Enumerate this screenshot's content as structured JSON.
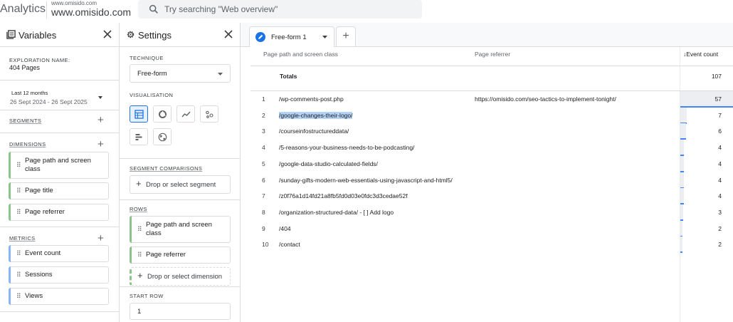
{
  "app": {
    "title": "Analytics",
    "property_small": "www.omisido.com",
    "property_name": "www.omisido.com",
    "search_placeholder": "Try searching \"Web overview\""
  },
  "variables": {
    "title": "Variables",
    "exploration_name_label": "EXPLORATION NAME:",
    "exploration_name": "404 Pages",
    "date_label": "Last 12 months",
    "date_range": "26 Sept 2024 - 26 Sept 2025",
    "segments_label": "SEGMENTS",
    "dimensions_label": "DIMENSIONS",
    "dimensions": [
      "Page path and screen class",
      "Page title",
      "Page referrer"
    ],
    "metrics_label": "METRICS",
    "metrics": [
      "Event count",
      "Sessions",
      "Views"
    ]
  },
  "settings": {
    "title": "Settings",
    "technique_label": "TECHNIQUE",
    "technique": "Free-form",
    "visualisation_label": "VISUALISATION",
    "visualisation_icons": [
      "table-icon",
      "donut-chart-icon",
      "line-chart-icon",
      "scatter-plot-icon",
      "bar-chart-icon",
      "geo-map-icon"
    ],
    "segment_comparisons_label": "SEGMENT COMPARISONS",
    "drop_segment": "Drop or select segment",
    "rows_label": "ROWS",
    "rows": [
      "Page path and screen class",
      "Page referrer"
    ],
    "drop_dimension": "Drop or select dimension",
    "start_row_label": "START ROW",
    "start_row": "1"
  },
  "main": {
    "tab_label": "Free-form 1",
    "add_tab": "+",
    "col_path": "Page path and screen class",
    "col_referrer": "Page referrer",
    "col_metric": "↓Event count",
    "totals_label": "Totals",
    "totals_value": "107",
    "max_value": 57,
    "rows": [
      {
        "n": "1",
        "path": "/wp-comments-post.php",
        "referrer": "https://omisido.com/seo-tactics-to-implement-tonight/",
        "value": 57
      },
      {
        "n": "2",
        "path": "/google-changes-their-logo/",
        "referrer": "",
        "value": 7
      },
      {
        "n": "3",
        "path": "/courseinfostructureddata/",
        "referrer": "",
        "value": 6
      },
      {
        "n": "4",
        "path": "/5-reasons-your-business-needs-to-be-podcasting/",
        "referrer": "",
        "value": 4
      },
      {
        "n": "5",
        "path": "/google-data-studio-calculated-fields/",
        "referrer": "",
        "value": 4
      },
      {
        "n": "6",
        "path": "/sunday-gifts-modern-web-essentials-using-javascript-and-html5/",
        "referrer": "",
        "value": 4
      },
      {
        "n": "7",
        "path": "/z0f76a1d14fd21a8fb5fd0d03e0fdc3d3cedae52f",
        "referrer": "",
        "value": 4
      },
      {
        "n": "8",
        "path": "/organization-structured-data/ - [ ] Add logo",
        "referrer": "",
        "value": 3
      },
      {
        "n": "9",
        "path": "/404",
        "referrer": "",
        "value": 2
      },
      {
        "n": "10",
        "path": "/contact",
        "referrer": "",
        "value": 2
      }
    ]
  },
  "colors": {
    "accent": "#1a73e8",
    "dimension_bar": "#8bc48a",
    "metric_bar": "#8ab4f8",
    "selection": "#b3d3f7"
  }
}
